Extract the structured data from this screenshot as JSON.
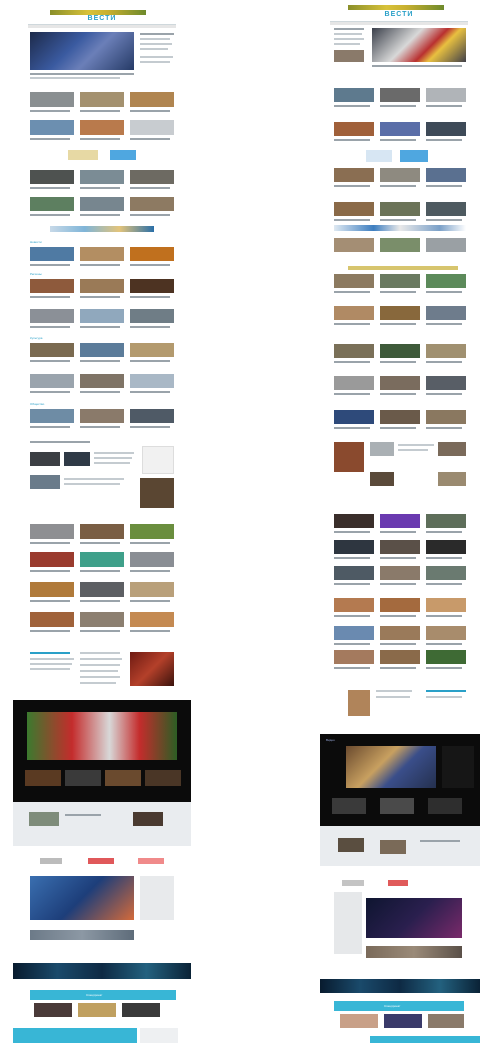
{
  "site": {
    "left_logo_text": "ВЕСТИ",
    "right_logo_text": "ВЕСТИ"
  },
  "left_column": {
    "section_labels": [
      "Новости",
      "Регионы",
      "Культура",
      "Общество"
    ],
    "footer_label": "Спецпроект"
  },
  "right_column": {
    "section_labels": [
      "Новости",
      "Видео"
    ],
    "footer_label": "Спецпроект"
  },
  "colors": {
    "accent": "#2aa0c8",
    "dark_block": "#0b0b0b",
    "teal_band": "#38b6d6"
  }
}
